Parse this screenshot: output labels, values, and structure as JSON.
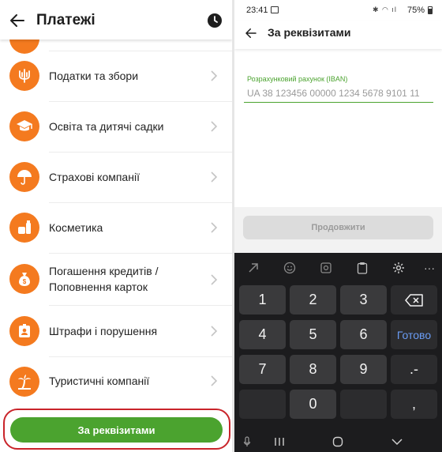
{
  "left": {
    "title": "Платежі",
    "categories": [
      {
        "label": "Податки та збори",
        "icon": "trident-icon"
      },
      {
        "label": "Освіта та дитячі садки",
        "icon": "graduation-cap-icon"
      },
      {
        "label": "Страхові компанії",
        "icon": "umbrella-icon"
      },
      {
        "label": "Косметика",
        "icon": "cosmetics-icon"
      },
      {
        "label": "Погашення кредитів /\nПоповнення карток",
        "icon": "money-bag-icon"
      },
      {
        "label": "Штрафи і порушення",
        "icon": "badge-icon"
      },
      {
        "label": "Туристичні компанії",
        "icon": "palm-tree-icon"
      }
    ],
    "requisites_button": "За реквізитами"
  },
  "right": {
    "status": {
      "time": "23:41",
      "icons": "✱ ◠ ıl",
      "battery": "75%"
    },
    "title": "За реквізитами",
    "iban": {
      "label": "Розрахунковий рахунок (IBAN)",
      "placeholder": "UA 38 123456 00000 1234 5678 9101 11",
      "value": ""
    },
    "continue_button": "Продовжити",
    "keyboard": {
      "rows": [
        [
          "1",
          "2",
          "3",
          "⌫"
        ],
        [
          "4",
          "5",
          "6",
          "Готово"
        ],
        [
          "7",
          "8",
          "9",
          ".-"
        ],
        [
          "",
          "0",
          "",
          ","
        ]
      ]
    }
  },
  "colors": {
    "accent_orange": "#f47a1f",
    "accent_green": "#4ba32f",
    "highlight_red": "#c9242a"
  }
}
